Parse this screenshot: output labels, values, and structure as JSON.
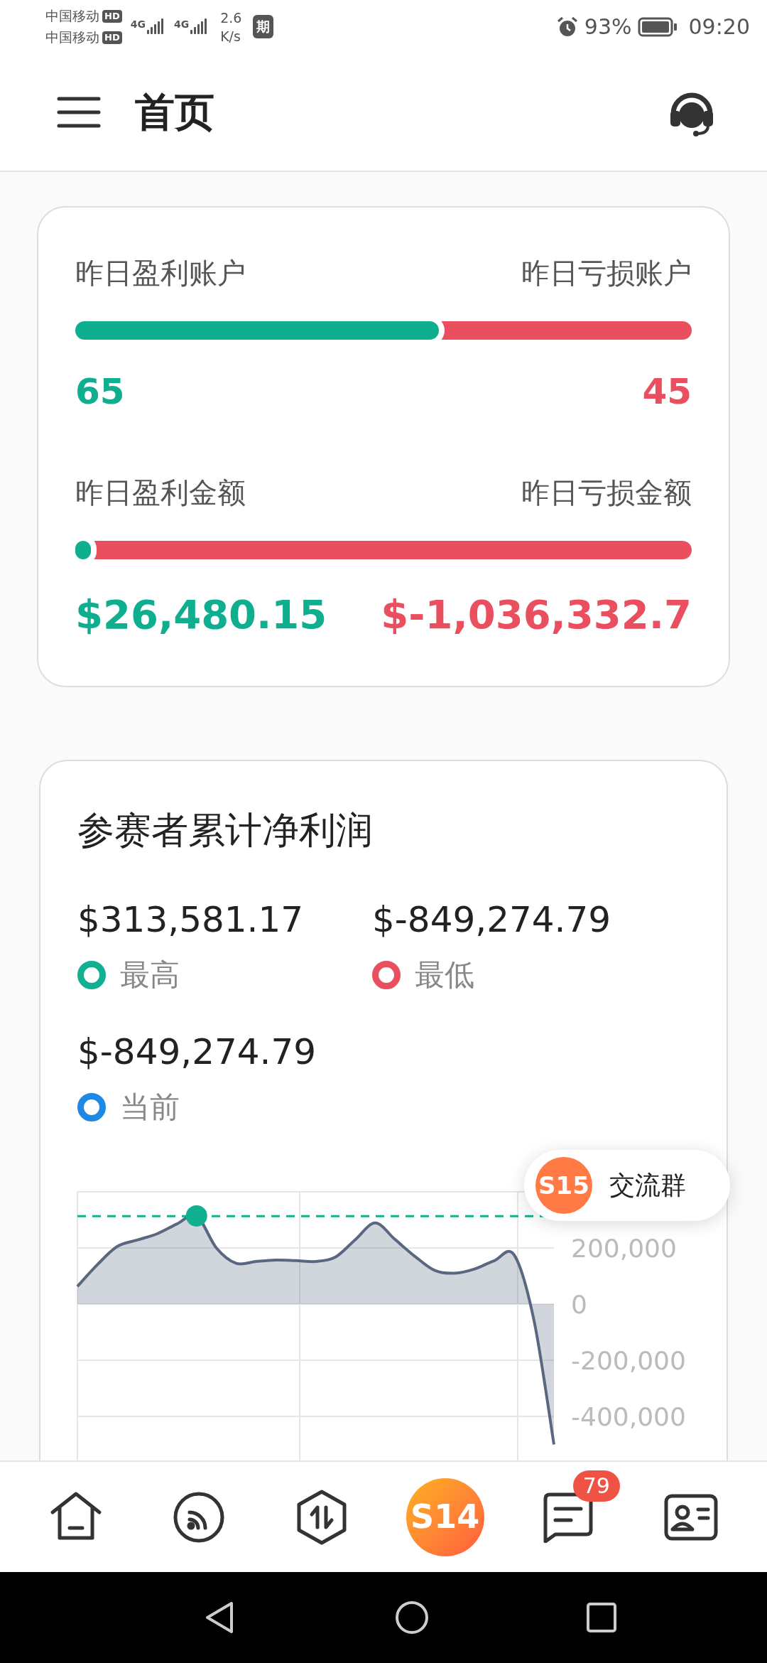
{
  "status_bar": {
    "carriers": [
      {
        "name": "中国移动",
        "badge": "HD",
        "network": "4G"
      },
      {
        "name": "中国移动",
        "badge": "HD",
        "network": "4G"
      }
    ],
    "speed_value": "2.6",
    "speed_unit": "K/s",
    "app_badge": "期",
    "battery": "93%",
    "time": "09:20"
  },
  "header": {
    "title": "首页"
  },
  "summary": {
    "rows": [
      {
        "left_label": "昨日盈利账户",
        "right_label": "昨日亏损账户",
        "level": 0.59,
        "left_value": "65",
        "right_value": "45",
        "kind": "count"
      },
      {
        "left_label": "昨日盈利金额",
        "right_label": "昨日亏损金额",
        "level": 0.025,
        "left_value": "$26,480.15",
        "right_value": "$-1,036,332.7",
        "kind": "amount"
      }
    ]
  },
  "profit": {
    "title": "参赛者累计净利润",
    "stats": [
      {
        "value": "$313,581.17",
        "label": "最高",
        "color": "#10b090"
      },
      {
        "value": "$-849,274.79",
        "label": "最低",
        "color": "#e9505f"
      },
      {
        "value": "$-849,274.79",
        "label": "当前",
        "color": "#1e88e5"
      }
    ],
    "chart_data": {
      "type": "area",
      "grid": true,
      "series": [
        {
          "color": "#5a6780",
          "values": [
            63000,
            140000,
            205000,
            228000,
            250000,
            285000,
            314000,
            200000,
            145000,
            152000,
            157000,
            155000,
            152000,
            168000,
            230000,
            289000,
            230000,
            170000,
            120000,
            110000,
            125000,
            155000,
            175000,
            -60000,
            -500000
          ]
        }
      ],
      "ref_lines": [
        {
          "axis": "y",
          "value": 313581.17,
          "color": "#10b090"
        }
      ],
      "ylim": [
        -600000,
        400000
      ],
      "yticks": [
        {
          "value": 200000,
          "label": "200,000"
        },
        {
          "value": 0,
          "label": "0"
        },
        {
          "value": -200000,
          "label": "-200,000"
        },
        {
          "value": -400000,
          "label": "-400,000"
        }
      ]
    }
  },
  "float_button": {
    "logo": "S15",
    "label": "交流群"
  },
  "bottom_nav": {
    "items": [
      {
        "kind": "home"
      },
      {
        "kind": "feed"
      },
      {
        "kind": "swap"
      },
      {
        "kind": "logo",
        "label": "S14"
      },
      {
        "kind": "chat",
        "badge": "79"
      },
      {
        "kind": "profile"
      }
    ]
  }
}
